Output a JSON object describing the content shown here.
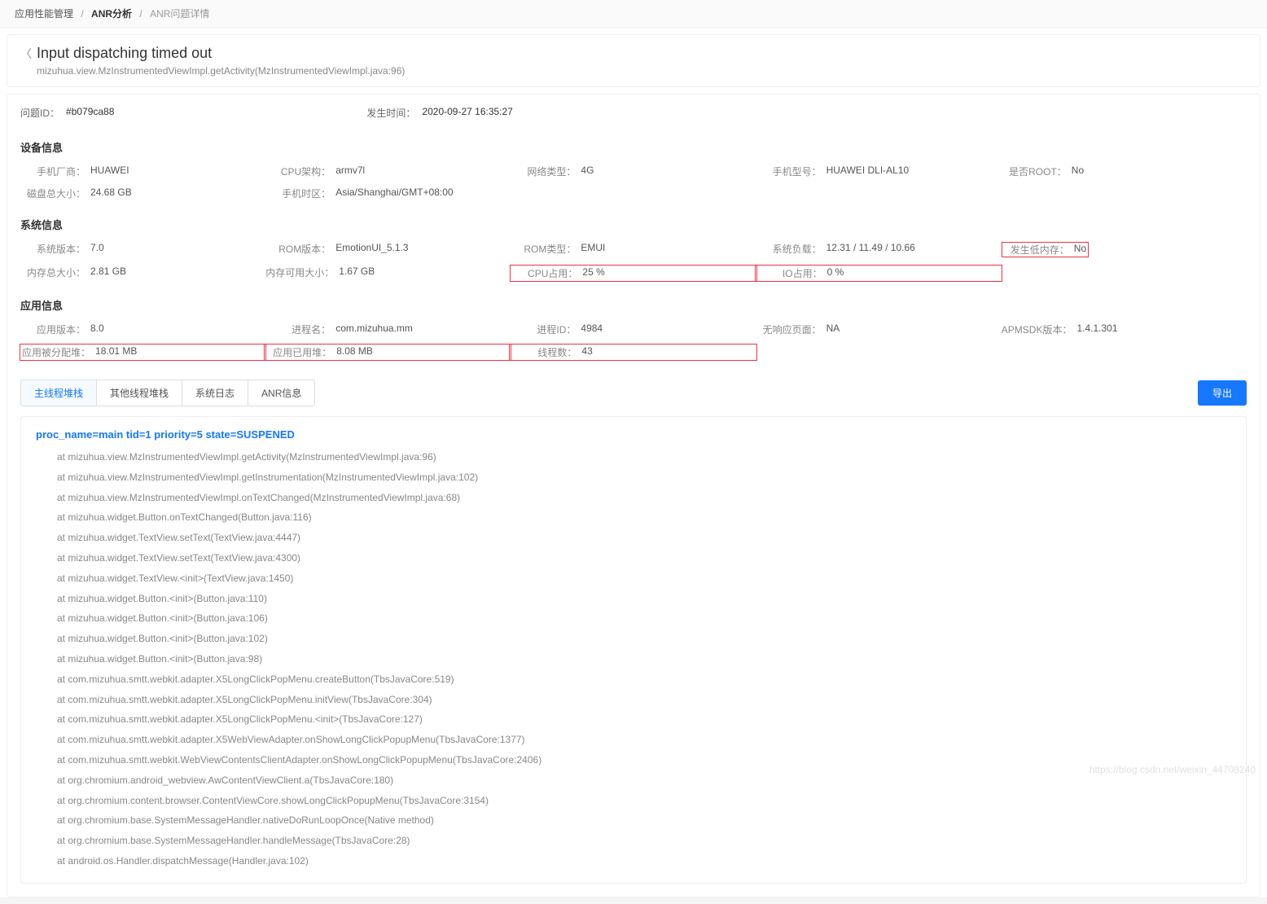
{
  "breadcrumb": {
    "item1": "应用性能管理",
    "item2": "ANR分析",
    "item3": "ANR问题详情"
  },
  "header": {
    "title": "Input dispatching timed out",
    "subtitle": "mizuhua.view.MzInstrumentedViewImpl.getActivity(MzInstrumentedViewImpl.java:96)"
  },
  "meta": {
    "problem_id_label": "问题ID：",
    "problem_id": "#b079ca88",
    "time_label": "发生时间：",
    "time": "2020-09-27 16:35:27"
  },
  "sections": {
    "device_title": "设备信息",
    "system_title": "系统信息",
    "app_title": "应用信息"
  },
  "device": {
    "vendor_label": "手机厂商：",
    "vendor": "HUAWEI",
    "cpu_arch_label": "CPU架构：",
    "cpu_arch": "armv7l",
    "net_type_label": "网络类型：",
    "net_type": "4G",
    "model_label": "手机型号：",
    "model": "HUAWEI DLI-AL10",
    "root_label": "是否ROOT：",
    "root": "No",
    "disk_label": "磁盘总大小：",
    "disk": "24.68 GB",
    "tz_label": "手机时区：",
    "tz": "Asia/Shanghai/GMT+08:00"
  },
  "system": {
    "sys_ver_label": "系统版本：",
    "sys_ver": "7.0",
    "rom_ver_label": "ROM版本：",
    "rom_ver": "EmotionUI_5.1.3",
    "rom_type_label": "ROM类型：",
    "rom_type": "EMUI",
    "load_label": "系统负载：",
    "load": "12.31 / 11.49 / 10.66",
    "lowmem_label": "发生低内存：",
    "lowmem": "No",
    "mem_total_label": "内存总大小：",
    "mem_total": "2.81 GB",
    "mem_avail_label": "内存可用大小：",
    "mem_avail": "1.67 GB",
    "cpu_label": "CPU占用：",
    "cpu": "25 %",
    "io_label": "IO占用：",
    "io": "0 %"
  },
  "app": {
    "app_ver_label": "应用版本：",
    "app_ver": "8.0",
    "proc_name_label": "进程名：",
    "proc_name": "com.mizuhua.mm",
    "proc_id_label": "进程ID：",
    "proc_id": "4984",
    "no_resp_label": "无响应页面：",
    "no_resp": "NA",
    "sdk_label": "APMSDK版本：",
    "sdk": "1.4.1.301",
    "alloc_label": "应用被分配堆：",
    "alloc": "18.01 MB",
    "used_label": "应用已用堆：",
    "used": "8.08 MB",
    "threads_label": "线程数：",
    "threads": "43"
  },
  "tabs": {
    "t1": "主线程堆栈",
    "t2": "其他线程堆栈",
    "t3": "系统日志",
    "t4": "ANR信息"
  },
  "export_label": "导出",
  "stack": {
    "header": "proc_name=main tid=1 priority=5 state=SUSPENED",
    "lines": [
      "at mizuhua.view.MzInstrumentedViewImpl.getActivity(MzInstrumentedViewImpl.java:96)",
      "at mizuhua.view.MzInstrumentedViewImpl.getInstrumentation(MzInstrumentedViewImpl.java:102)",
      "at mizuhua.view.MzInstrumentedViewImpl.onTextChanged(MzInstrumentedViewImpl.java:68)",
      "at mizuhua.widget.Button.onTextChanged(Button.java:116)",
      "at mizuhua.widget.TextView.setText(TextView.java:4447)",
      "at mizuhua.widget.TextView.setText(TextView.java:4300)",
      "at mizuhua.widget.TextView.<init>(TextView.java:1450)",
      "at mizuhua.widget.Button.<init>(Button.java:110)",
      "at mizuhua.widget.Button.<init>(Button.java:106)",
      "at mizuhua.widget.Button.<init>(Button.java:102)",
      "at mizuhua.widget.Button.<init>(Button.java:98)",
      "at com.mizuhua.smtt.webkit.adapter.X5LongClickPopMenu.createButton(TbsJavaCore:519)",
      "at com.mizuhua.smtt.webkit.adapter.X5LongClickPopMenu.initView(TbsJavaCore:304)",
      "at com.mizuhua.smtt.webkit.adapter.X5LongClickPopMenu.<init>(TbsJavaCore:127)",
      "at com.mizuhua.smtt.webkit.adapter.X5WebViewAdapter.onShowLongClickPopupMenu(TbsJavaCore:1377)",
      "at com.mizuhua.smtt.webkit.WebViewContentsClientAdapter.onShowLongClickPopupMenu(TbsJavaCore:2406)",
      "at org.chromium.android_webview.AwContentViewClient.a(TbsJavaCore:180)",
      "at org.chromium.content.browser.ContentViewCore.showLongClickPopupMenu(TbsJavaCore:3154)",
      "at org.chromium.base.SystemMessageHandler.nativeDoRunLoopOnce(Native method)",
      "at org.chromium.base.SystemMessageHandler.handleMessage(TbsJavaCore:28)",
      "at android.os.Handler.dispatchMessage(Handler.java:102)"
    ]
  },
  "watermark": "https://blog.csdn.net/weixin_44708240"
}
